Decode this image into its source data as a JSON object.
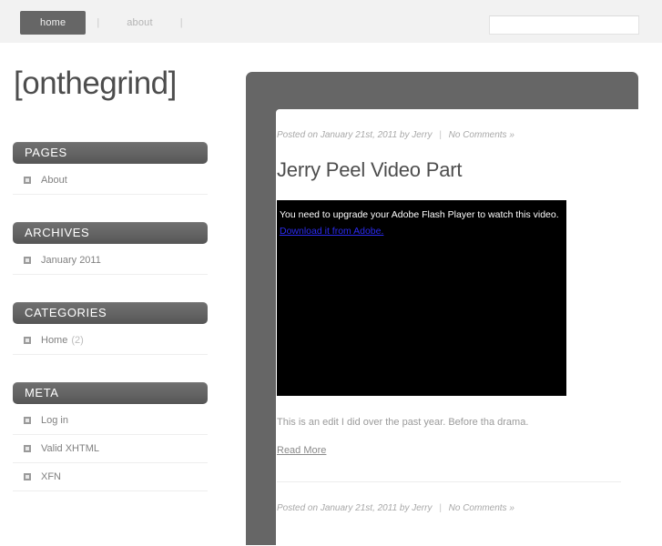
{
  "topnav": {
    "items": [
      {
        "label": "home",
        "active": true
      },
      {
        "label": "about",
        "active": false
      }
    ],
    "separator": "|"
  },
  "search": {
    "value": "",
    "placeholder": ""
  },
  "site": {
    "title": "[onthegrind]"
  },
  "sidebar": {
    "widgets": [
      {
        "title": "PAGES",
        "items": [
          {
            "label": "About",
            "count": ""
          }
        ]
      },
      {
        "title": "ARCHIVES",
        "items": [
          {
            "label": "January 2011",
            "count": ""
          }
        ]
      },
      {
        "title": "CATEGORIES",
        "items": [
          {
            "label": "Home",
            "count": "(2)"
          }
        ]
      },
      {
        "title": "META",
        "items": [
          {
            "label": "Log in",
            "count": ""
          },
          {
            "label": "Valid XHTML",
            "count": ""
          },
          {
            "label": "XFN",
            "count": ""
          }
        ]
      }
    ]
  },
  "main": {
    "posts": [
      {
        "meta_prefix": "Posted on January 21st, 2011 by Jerry",
        "meta_sep": "|",
        "comments": "No Comments »",
        "title": "Jerry Peel Video Part",
        "video": {
          "message": "You need to upgrade your Adobe Flash Player to watch this video.",
          "link_label": "Download it from Adobe."
        },
        "body": "This is an edit I did over the past year. Before tha drama.",
        "read_more": "Read More"
      },
      {
        "meta_prefix": "Posted on January 21st, 2011 by Jerry",
        "meta_sep": "|",
        "comments": "No Comments »"
      }
    ]
  },
  "colors": {
    "topbar_bg": "#f2f2f2",
    "nav_active_bg": "#666666",
    "panel_bg": "#666666",
    "widget_header": "#5f5f5f",
    "title_text": "#4d4d4d",
    "body_text": "#9a9a9a",
    "flash_link": "#2b2bf0"
  }
}
